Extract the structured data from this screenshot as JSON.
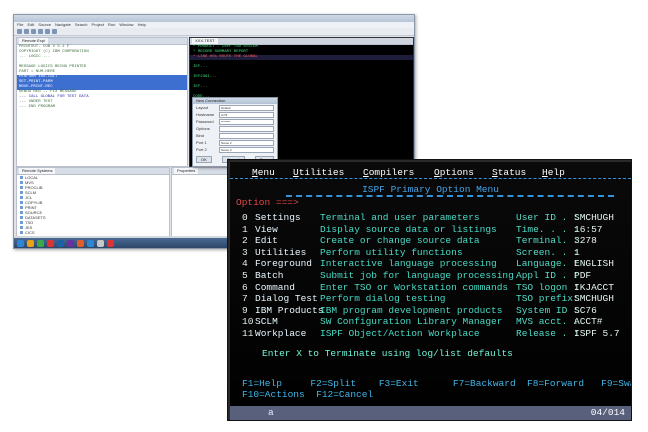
{
  "ide": {
    "menu": [
      "File",
      "Edit",
      "Source",
      "Navigate",
      "Search",
      "Project",
      "Run",
      "Window",
      "Help"
    ],
    "editor_tab": "Remote Expl",
    "editor_lines": [
      {
        "text": "PRINTOUT.  COB  V 5.1 F"
      },
      {
        "text": "COPYRIGHT (C) IBM CORPORATION"
      },
      {
        "text": "  ...  LOGIC ..."
      },
      {
        "text": ""
      },
      {
        "text": "MESSAGE LOGICS BEING PRINTED"
      },
      {
        "text": "  PART  =   NUM-HERE"
      },
      {
        "text": "     PERFORM  100-INIT",
        "hl": true
      },
      {
        "text": "     SET-PRINT-PARM",
        "hl": true
      },
      {
        "text": "     MOVE-PRINT-REC",
        "hl": true
      },
      {
        "text": "DEBUG  REG -- FIX MESSAGE"
      },
      {
        "text": "  --- CALL GLOBAL  FOR TEST DATA",
        "blue": true
      },
      {
        "text": "  --- UNDER TEST"
      },
      {
        "text": "  --- END PROGRAM"
      }
    ],
    "console_tab": "XXX-TEST",
    "console_lines": [
      {
        "text": "  *  PRODUCT - ISPF  TSO  SYSTEM"
      },
      {
        "text": "  *  RECORD SUMMARY REPORT"
      },
      {
        "text": "  *  LINE 001  ROUTE THE GLOBAL",
        "red": true
      },
      {
        "text": ""
      },
      {
        "text": "   IEF..."
      },
      {
        "text": ""
      },
      {
        "text": "   IEF236I..."
      },
      {
        "text": ""
      },
      {
        "text": "   IEF..."
      },
      {
        "text": ""
      },
      {
        "text": "   CODE..."
      },
      {
        "text": ""
      },
      {
        "text": "   IEF285I"
      }
    ],
    "tree_tab": "Remote Systems",
    "tree_items": [
      "LOCAL",
      "MVS",
      "PROCLIB",
      "SCLM",
      "JCL",
      "COPYLIB",
      "PRINT",
      "SOURCE",
      "DATASETS",
      "TSO",
      "JES",
      "CICS",
      "DB2"
    ],
    "props_tab": "Properties",
    "outline_tab": "Remote Error List",
    "outline_items": [
      "ERROR 1",
      "ERROR 2",
      "ERROR 3",
      "ERROR 4",
      "ERROR 5",
      "ERROR 6",
      "ERROR 7",
      "ERROR 8"
    ],
    "taskbar_colors": [
      "#2f86d6",
      "#e8a317",
      "#3aa84b",
      "#d33",
      "#1f5fa8",
      "#6a2fa3",
      "#e25d2b",
      "#2f86d6",
      "#c8c8c8",
      "#d33"
    ],
    "dialog": {
      "title": "New Connection",
      "fields": [
        {
          "label": "Layout",
          "value": "Default"
        },
        {
          "label": "Hostname",
          "value": "sc76"
        },
        {
          "label": "Password",
          "value": "********"
        },
        {
          "label": "Options",
          "value": ""
        },
        {
          "label": "Bind",
          "value": ""
        },
        {
          "label": "Port 1",
          "value": "Name 2"
        },
        {
          "label": "Port 2",
          "value": "Name 3"
        }
      ],
      "ok": "OK",
      "cancel": "Cancel",
      "save": "Save"
    }
  },
  "terminal": {
    "menu": [
      {
        "hot": "M",
        "rest": "enu"
      },
      {
        "hot": "U",
        "rest": "tilities"
      },
      {
        "hot": "C",
        "rest": "ompilers"
      },
      {
        "hot": "O",
        "rest": "ptions"
      },
      {
        "hot": "S",
        "rest": "tatus"
      },
      {
        "hot": "H",
        "rest": "elp"
      }
    ],
    "title": "ISPF Primary Option Menu",
    "option_label": "Option ===>",
    "options": [
      {
        "key": "0",
        "name": "Settings",
        "desc": "Terminal and user parameters"
      },
      {
        "key": "1",
        "name": "View",
        "desc": "Display source data or listings"
      },
      {
        "key": "2",
        "name": "Edit",
        "desc": "Create or change source data"
      },
      {
        "key": "3",
        "name": "Utilities",
        "desc": "Perform utility functions"
      },
      {
        "key": "4",
        "name": "Foreground",
        "desc": "Interactive language processing"
      },
      {
        "key": "5",
        "name": "Batch",
        "desc": "Submit job for language processing"
      },
      {
        "key": "6",
        "name": "Command",
        "desc": "Enter TSO or Workstation commands"
      },
      {
        "key": "7",
        "name": "Dialog Test",
        "desc": "Perform dialog testing"
      },
      {
        "key": "9",
        "name": "IBM Products",
        "desc": "IBM program development products"
      },
      {
        "key": "10",
        "name": "SCLM",
        "desc": "SW Configuration Library Manager"
      },
      {
        "key": "11",
        "name": "Workplace",
        "desc": "ISPF Object/Action Workplace"
      }
    ],
    "info": [
      {
        "label": "User ID . :",
        "value": "SMCHUGH"
      },
      {
        "label": "Time. . . :",
        "value": "16:57"
      },
      {
        "label": "Terminal. :",
        "value": "3278"
      },
      {
        "label": "Screen. . :",
        "value": "1"
      },
      {
        "label": "Language. :",
        "value": "ENGLISH"
      },
      {
        "label": "Appl ID . :",
        "value": "PDF"
      },
      {
        "label": "TSO logon :",
        "value": "IKJACCT"
      },
      {
        "label": "TSO prefix:",
        "value": "SMCHUGH"
      },
      {
        "label": "System ID :",
        "value": "SC76"
      },
      {
        "label": "MVS acct. :",
        "value": "ACCT#"
      },
      {
        "label": "Release . :",
        "value": "ISPF 5.7"
      }
    ],
    "terminate_msg": "Enter X to Terminate using log/list defaults",
    "pf_row1": "F1=Help     F2=Split    F3=Exit      F7=Backward  F8=Forward   F9=Swap",
    "pf_row2": "F10=Actions  F12=Cancel",
    "footer_indicator": "a",
    "cursor_pos": "04/014"
  }
}
